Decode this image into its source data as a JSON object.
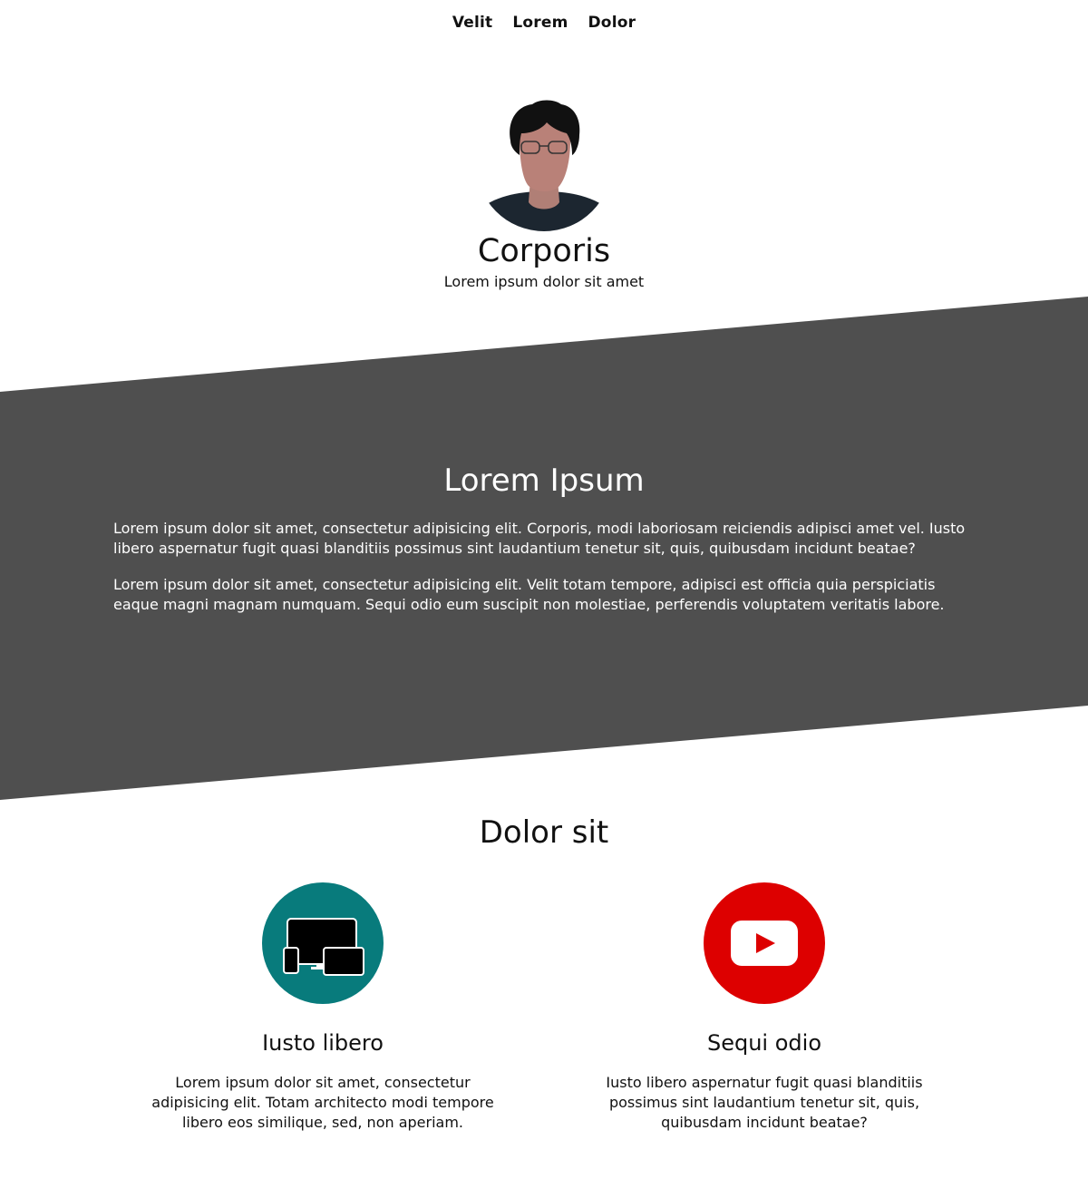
{
  "nav": {
    "items": [
      {
        "label": "Velit"
      },
      {
        "label": "Lorem"
      },
      {
        "label": "Dolor"
      }
    ]
  },
  "hero": {
    "title": "Corporis",
    "subtitle": "Lorem ipsum dolor sit amet"
  },
  "about": {
    "title": "Lorem Ipsum",
    "paragraphs": [
      "Lorem ipsum dolor sit amet, consectetur adipisicing elit. Corporis, modi laboriosam reiciendis adipisci amet vel. Iusto libero aspernatur fugit quasi blanditiis possimus sint laudantium tenetur sit, quis, quibusdam incidunt beatae?",
      "Lorem ipsum dolor sit amet, consectetur adipisicing elit. Velit totam tempore, adipisci est officia quia perspiciatis eaque magni magnam numquam. Sequi odio eum suscipit non molestiae, perferendis voluptatem veritatis labore."
    ]
  },
  "features": {
    "title": "Dolor sit",
    "items": [
      {
        "icon": "devices-icon",
        "title": "Iusto libero",
        "text": "Lorem ipsum dolor sit amet, consectetur adipisicing elit. Totam architecto modi tempore libero eos similique, sed, non aperiam.",
        "color": "#087b7c"
      },
      {
        "icon": "youtube-icon",
        "title": "Sequi odio",
        "text": "Iusto libero aspernatur fugit quasi blanditiis possimus sint laudantium tenetur sit, quis, quibusdam incidunt beatae?",
        "color": "#dd0000"
      }
    ]
  },
  "colors": {
    "slant_band": "#4f4f4f",
    "text": "#111111",
    "background": "#ffffff"
  }
}
